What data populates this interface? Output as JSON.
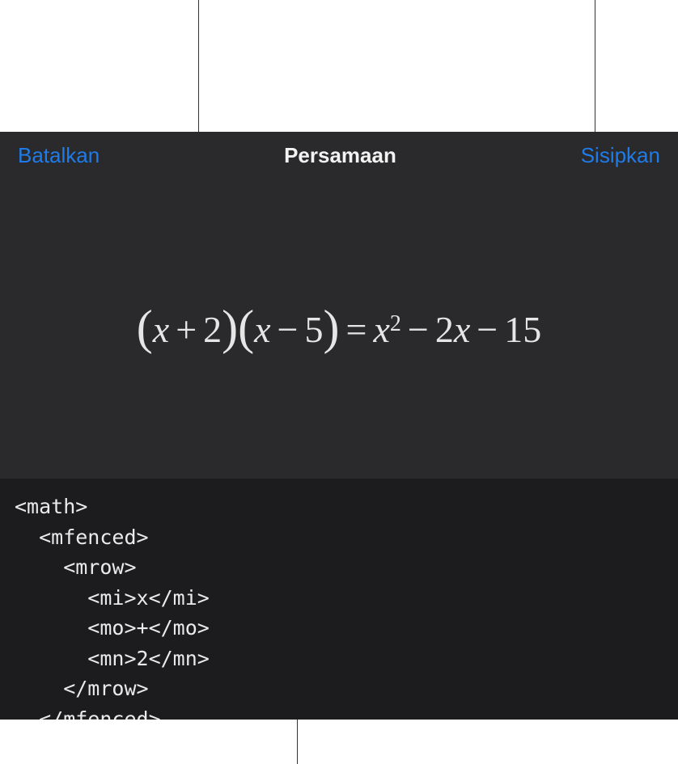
{
  "header": {
    "cancel_label": "Batalkan",
    "title": "Persamaan",
    "insert_label": "Sisipkan"
  },
  "equation": {
    "lhs_group1_var": "x",
    "lhs_group1_op": "+",
    "lhs_group1_num": "2",
    "lhs_group2_var": "x",
    "lhs_group2_op": "−",
    "lhs_group2_num": "5",
    "eq": "=",
    "rhs_term1_var": "x",
    "rhs_term1_exp": "2",
    "rhs_op1": "−",
    "rhs_term2_coef": "2",
    "rhs_term2_var": "x",
    "rhs_op2": "−",
    "rhs_term3": "15"
  },
  "code": "<math>\n  <mfenced>\n    <mrow>\n      <mi>x</mi>\n      <mo>+</mo>\n      <mn>2</mn>\n    </mrow>\n  </mfenced>\n  <mfenced>\n    <mrow>"
}
